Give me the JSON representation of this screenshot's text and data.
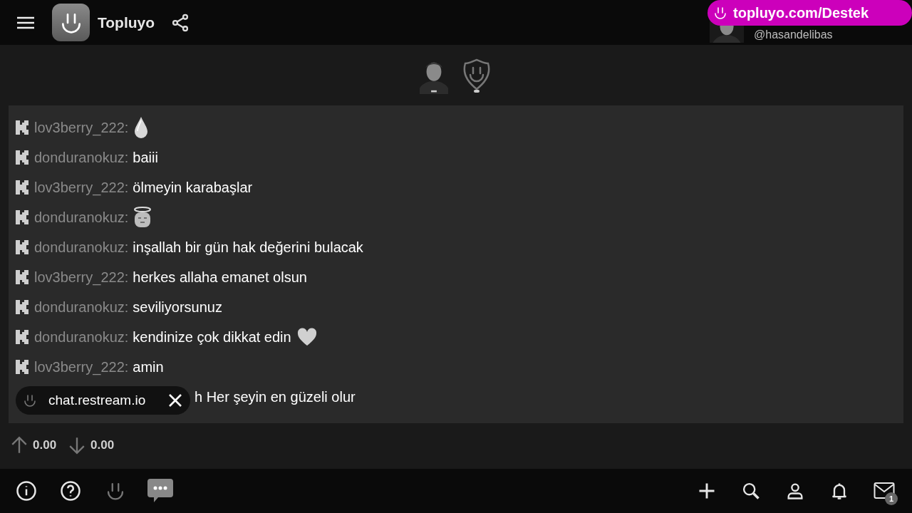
{
  "header": {
    "app_name": "Topluyo",
    "user_handle": "@hasandelibas",
    "promo_badge": "topluyo.com/Destek"
  },
  "chat": {
    "messages": [
      {
        "kind": "drop",
        "user": "lov3berry_222:"
      },
      {
        "kind": "text",
        "user": "donduranokuz:",
        "text": "baiii"
      },
      {
        "kind": "text",
        "user": "lov3berry_222:",
        "text": "ölmeyin karabaşlar"
      },
      {
        "kind": "halo",
        "user": "donduranokuz:"
      },
      {
        "kind": "text",
        "user": "donduranokuz:",
        "text": "inşallah bir gün hak değerini bulacak"
      },
      {
        "kind": "text",
        "user": "lov3berry_222:",
        "text": "herkes allaha emanet olsun"
      },
      {
        "kind": "text",
        "user": "donduranokuz:",
        "text": "seviliyorsunuz"
      },
      {
        "kind": "text",
        "user": "donduranokuz:",
        "text": "kendinize çok dikkat edin",
        "heart": true
      },
      {
        "kind": "text",
        "user": "lov3berry_222:",
        "text": "amin"
      },
      {
        "kind": "covered",
        "text": "h Her şeyin en güzeli olur"
      }
    ]
  },
  "toast": {
    "text": "chat.restream.io"
  },
  "stats": {
    "upload": "0.00",
    "download": "0.00"
  },
  "bottom_bar": {
    "mail_badge": "1"
  }
}
